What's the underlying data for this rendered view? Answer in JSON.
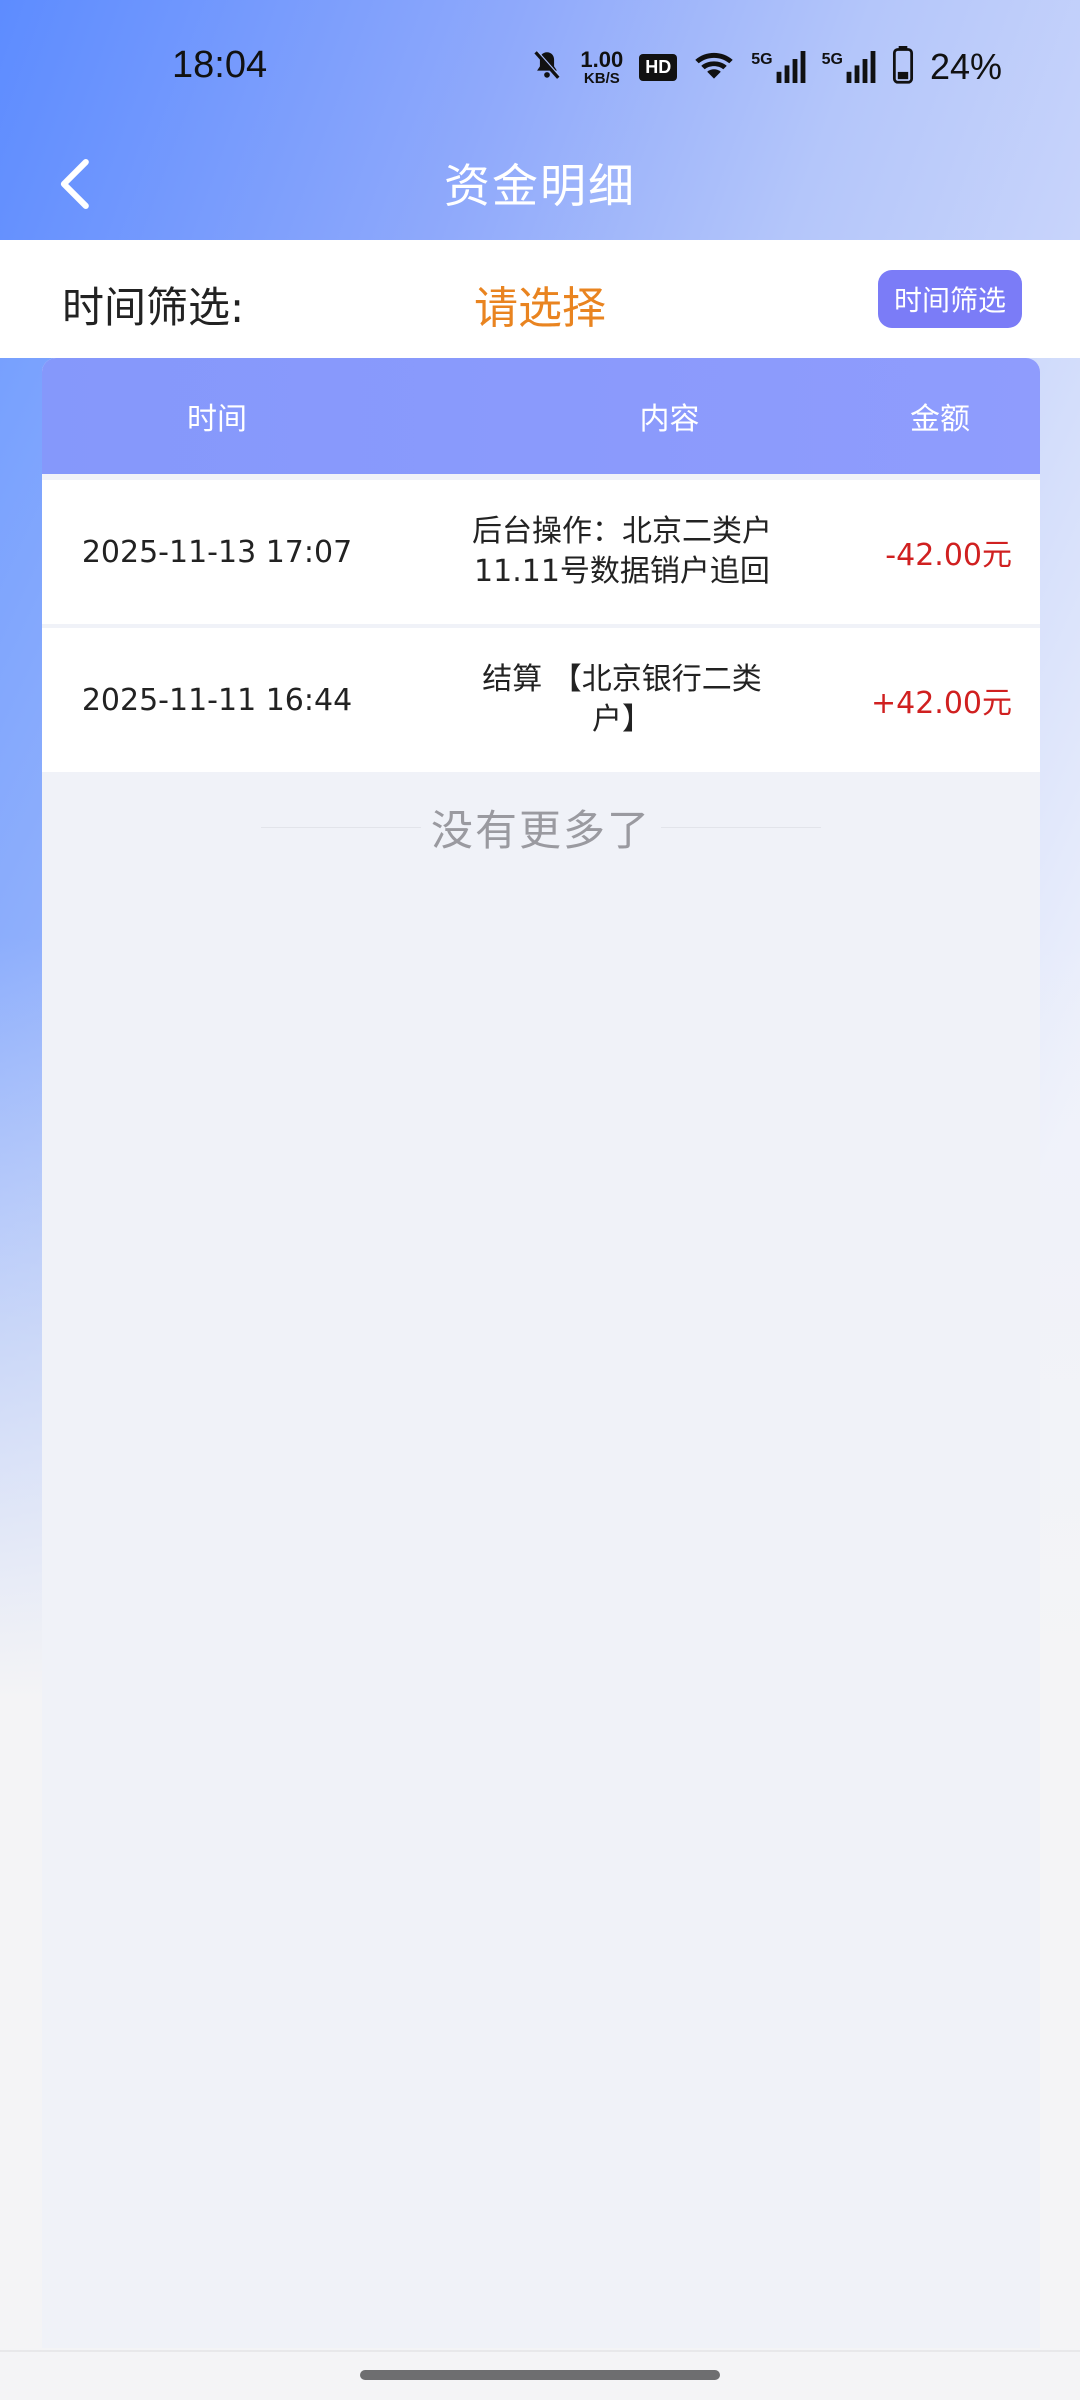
{
  "status_bar": {
    "time": "18:04",
    "net_speed_value": "1.00",
    "net_speed_unit": "KB/S",
    "hd_label": "HD",
    "signal1_label": "5G",
    "signal2_label": "5G",
    "battery": "24%"
  },
  "nav": {
    "title": "资金明细"
  },
  "filter": {
    "label": "时间筛选:",
    "value": "请选择",
    "button_label": "时间筛选"
  },
  "table": {
    "headers": {
      "time": "时间",
      "content": "内容",
      "amount": "金额"
    },
    "rows": [
      {
        "time": "2025-11-13 17:07",
        "content": "后台操作：北京二类户11.11号数据销户追回",
        "amount": "-42.00元"
      },
      {
        "time": "2025-11-11 16:44",
        "content": "结算 【北京银行二类户】",
        "amount": "+42.00元"
      }
    ],
    "end_text": "没有更多了"
  },
  "colors": {
    "accent": "#7b7cf7",
    "filter_value": "#e98420",
    "amount": "#d02020"
  }
}
